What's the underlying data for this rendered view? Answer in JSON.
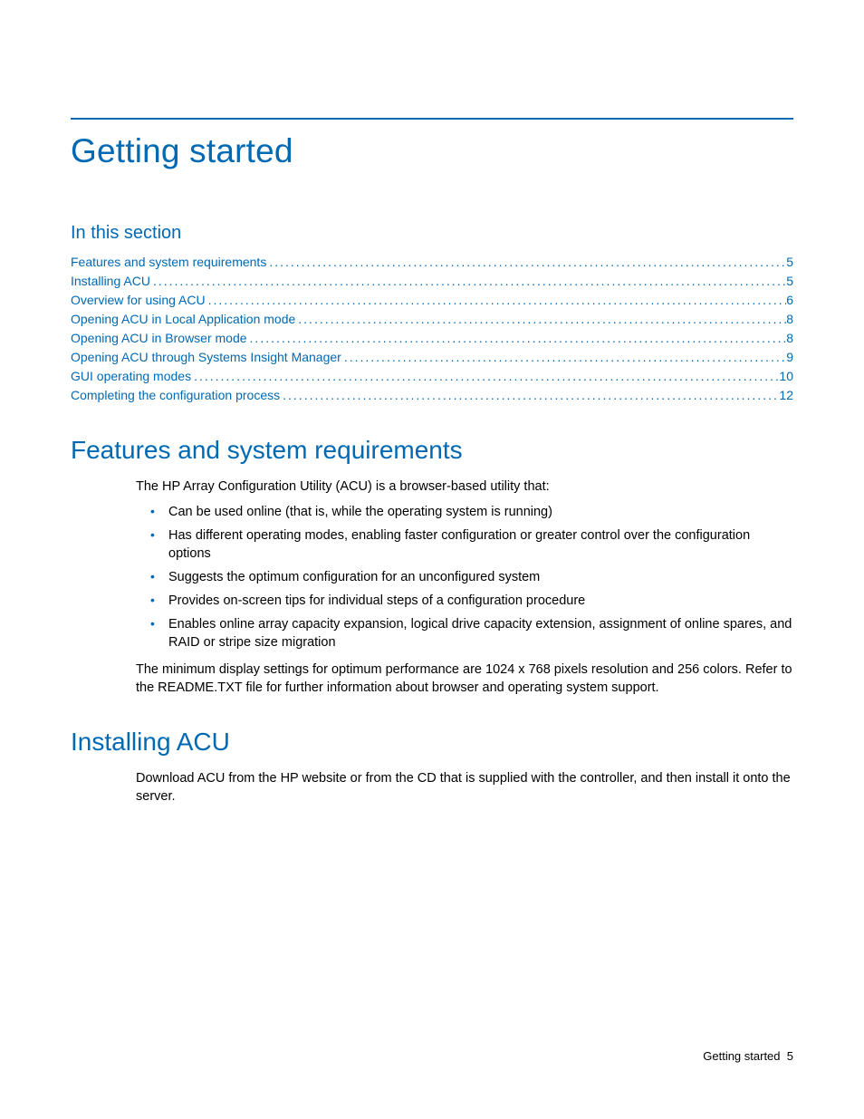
{
  "title": "Getting started",
  "toc_header": "In this section",
  "toc": [
    {
      "label": "Features and system requirements",
      "page": "5"
    },
    {
      "label": "Installing ACU",
      "page": "5"
    },
    {
      "label": "Overview for using ACU",
      "page": "6"
    },
    {
      "label": "Opening ACU in Local Application mode",
      "page": "8"
    },
    {
      "label": "Opening ACU in Browser mode",
      "page": "8"
    },
    {
      "label": "Opening ACU through Systems Insight Manager",
      "page": "9"
    },
    {
      "label": "GUI operating modes",
      "page": "10"
    },
    {
      "label": "Completing the configuration process",
      "page": "12"
    }
  ],
  "section1": {
    "heading": "Features and system requirements",
    "intro": "The HP Array Configuration Utility (ACU) is a browser-based utility that:",
    "bullets": [
      "Can be used online (that is, while the operating system is running)",
      "Has different operating modes, enabling faster configuration or greater control over the configuration options",
      "Suggests the optimum configuration for an unconfigured system",
      "Provides on-screen tips for individual steps of a configuration procedure",
      "Enables online array capacity expansion, logical drive capacity extension, assignment of online spares, and RAID or stripe size migration"
    ],
    "outro": "The minimum display settings for optimum performance are 1024 x 768 pixels resolution and 256 colors. Refer to the README.TXT file for further information about browser and operating system support."
  },
  "section2": {
    "heading": "Installing ACU",
    "body": "Download ACU from the HP website or from the CD that is supplied with the controller, and then install it onto the server."
  },
  "footer": {
    "label": "Getting started",
    "page": "5"
  }
}
